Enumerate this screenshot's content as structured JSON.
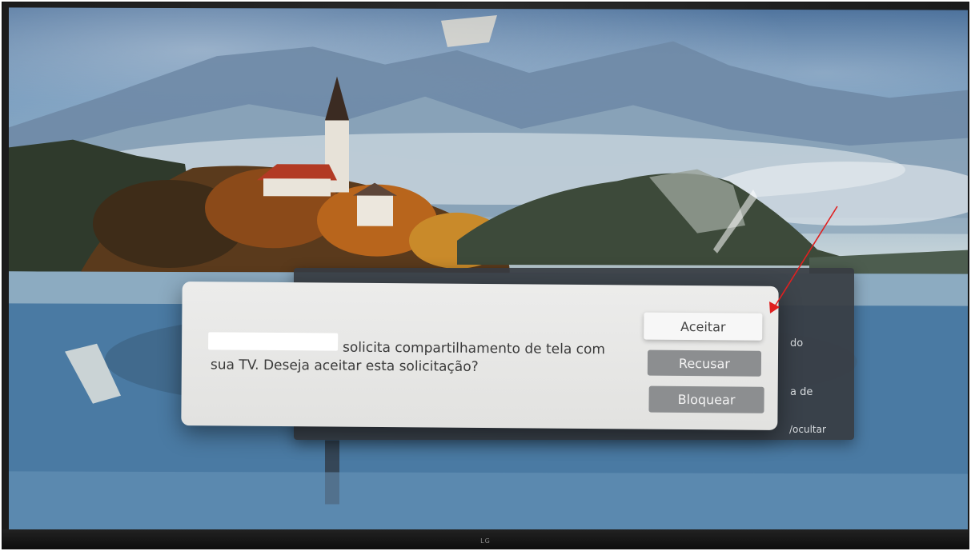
{
  "tv": {
    "brand_logo": "LG"
  },
  "dialog": {
    "message": "solicita compartilhamento de tela com sua TV. Deseja aceitar esta solicitação?",
    "buttons": {
      "accept": "Aceitar",
      "refuse": "Recusar",
      "block": "Bloquear"
    }
  },
  "background_panel": {
    "fragment_1": "do",
    "fragment_2": "a de",
    "fragment_3": "/ocultar"
  },
  "colors": {
    "annotation_arrow": "#e02020",
    "dialog_bg": "#e8e8e6",
    "button_selected": "#f7f7f7",
    "button_default": "#8c8e90"
  },
  "icons": {
    "annotation": "red-arrow-icon"
  }
}
